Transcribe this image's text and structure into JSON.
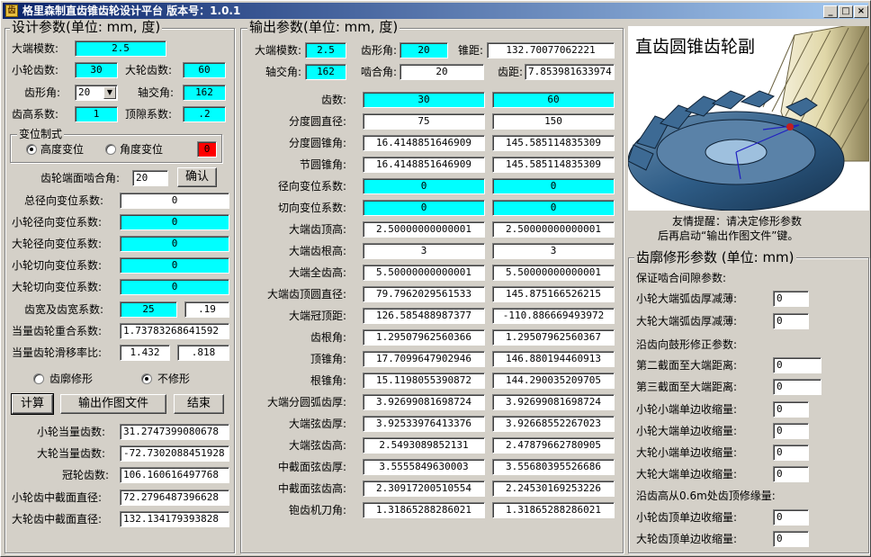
{
  "window": {
    "title": "格里森制直齿锥齿轮设计平台   版本号：1.0.1",
    "icon": "app-icon"
  },
  "design": {
    "title": "设计参数(单位: mm, 度)",
    "module_label": "大端模数:",
    "module": "2.5",
    "z1_label": "小轮齿数:",
    "z1": "30",
    "z2_label": "大轮齿数:",
    "z2": "60",
    "alpha_label": "齿形角:",
    "alpha": "20",
    "sigma_label": "轴交角:",
    "sigma": "162",
    "ha_label": "齿高系数:",
    "ha": "1",
    "c_label": "顶隙系数:",
    "c": ".2",
    "shift": {
      "title": "变位制式",
      "opt1": "高度变位",
      "opt2": "角度变位",
      "value": "0"
    },
    "pressure_label": "齿轮端面啮合角:",
    "pressure": "20",
    "confirm": "确认",
    "total_x_label": "总径向变位系数:",
    "total_x": "0",
    "x1_label": "小轮径向变位系数:",
    "x1": "0",
    "x2_label": "大轮径向变位系数:",
    "x2": "0",
    "xt1_label": "小轮切向变位系数:",
    "xt1": "0",
    "xt2_label": "大轮切向变位系数:",
    "xt2": "0",
    "width_label": "齿宽及齿宽系数:",
    "width": "25",
    "width_coef": ".19",
    "overlap_label": "当量齿轮重合系数:",
    "overlap": "1.73783268641592",
    "slide_label": "当量齿轮滑移率比:",
    "slide1": "1.432",
    "slide2": ".818",
    "mod_opt1": "齿廓修形",
    "mod_opt2": "不修形",
    "btn_calc": "计算",
    "btn_export": "输出作图文件",
    "btn_end": "结束",
    "zv1_label": "小轮当量齿数:",
    "zv1": "31.2747399080678",
    "zv2_label": "大轮当量齿数:",
    "zv2": "-72.7302088451928",
    "zc_label": "冠轮齿数:",
    "zc": "106.160616497768",
    "dm1_label": "小轮齿中截面直径:",
    "dm1": "72.2796487396628",
    "dm2_label": "大轮齿中截面直径:",
    "dm2": "132.134179393828"
  },
  "output": {
    "title": "输出参数(单位: mm, 度)",
    "head": {
      "module_label": "大端模数:",
      "module": "2.5",
      "alpha_label": "齿形角:",
      "alpha": "20",
      "cone_label": "锥距:",
      "cone": "132.70077062221",
      "sigma_label": "轴交角:",
      "sigma": "162",
      "mesh_label": "啮合角:",
      "mesh": "20",
      "pitch_label": "齿距:",
      "pitch": "7.853981633974"
    },
    "rows": [
      {
        "label": "齿数:",
        "v1": "30",
        "v2": "60",
        "cyan": true
      },
      {
        "label": "分度圆直径:",
        "v1": "75",
        "v2": "150",
        "cyan": false
      },
      {
        "label": "分度圆锥角:",
        "v1": "16.4148851646909",
        "v2": "145.585114835309",
        "cyan": false
      },
      {
        "label": "节圆锥角:",
        "v1": "16.4148851646909",
        "v2": "145.585114835309",
        "cyan": false
      },
      {
        "label": "径向变位系数:",
        "v1": "0",
        "v2": "0",
        "cyan": true
      },
      {
        "label": "切向变位系数:",
        "v1": "0",
        "v2": "0",
        "cyan": true
      },
      {
        "label": "大端齿顶高:",
        "v1": "2.50000000000001",
        "v2": "2.50000000000001",
        "cyan": false
      },
      {
        "label": "大端齿根高:",
        "v1": "3",
        "v2": "3",
        "cyan": false
      },
      {
        "label": "大端全齿高:",
        "v1": "5.50000000000001",
        "v2": "5.50000000000001",
        "cyan": false
      },
      {
        "label": "大端齿顶圆直径:",
        "v1": "79.7962029561533",
        "v2": "145.875166526215",
        "cyan": false
      },
      {
        "label": "大端冠顶距:",
        "v1": "126.585488987377",
        "v2": "-110.886669493972",
        "cyan": false
      },
      {
        "label": "齿根角:",
        "v1": "1.29507962560366",
        "v2": "1.29507962560367",
        "cyan": false
      },
      {
        "label": "顶锥角:",
        "v1": "17.7099647902946",
        "v2": "146.880194460913",
        "cyan": false
      },
      {
        "label": "根锥角:",
        "v1": "15.1198055390872",
        "v2": "144.290035209705",
        "cyan": false
      },
      {
        "label": "大端分圆弧齿厚:",
        "v1": "3.92699081698724",
        "v2": "3.92699081698724",
        "cyan": false
      },
      {
        "label": "大端弦齿厚:",
        "v1": "3.92533976413376",
        "v2": "3.92668552267023",
        "cyan": false
      },
      {
        "label": "大端弦齿高:",
        "v1": "2.5493089852131",
        "v2": "2.47879662780905",
        "cyan": false
      },
      {
        "label": "中截面弦齿厚:",
        "v1": "3.5555849630003",
        "v2": "3.55680395526686",
        "cyan": false
      },
      {
        "label": "中截面弦齿高:",
        "v1": "2.30917200510554",
        "v2": "2.24530169253226",
        "cyan": false
      },
      {
        "label": "铇齿机刀角:",
        "v1": "1.31865288286021",
        "v2": "1.31865288286021",
        "cyan": false
      }
    ]
  },
  "preview": {
    "title": "直齿圆锥齿轮副",
    "image": "bevel-gear-pair-render"
  },
  "tip": {
    "line1": "友情提醒：请决定修形参数",
    "line2": "后再启动“输出作图文件”键。"
  },
  "profile": {
    "title": "齿廓修形参数 (单位: mm)",
    "sec1": "保证啮合间隙参数:",
    "sec2": "沿齿向鼓形修正参数:",
    "sec3": "沿齿高从0.6m处齿顶修缘量:",
    "items": [
      {
        "label": "小轮大端弧齿厚减薄:",
        "value": "0"
      },
      {
        "label": "大轮大端弧齿厚减薄:",
        "value": "0"
      },
      {
        "label": "第二截面至大端距离:",
        "value": "0"
      },
      {
        "label": "第三截面至大端距离:",
        "value": "0"
      },
      {
        "label": "小轮小端单边收缩量:",
        "value": "0"
      },
      {
        "label": "小轮大端单边收缩量:",
        "value": "0"
      },
      {
        "label": "大轮小端单边收缩量:",
        "value": "0"
      },
      {
        "label": "大轮大端单边收缩量:",
        "value": "0"
      },
      {
        "label": "小轮齿顶单边收缩量:",
        "value": "0"
      },
      {
        "label": "大轮齿顶单边收缩量:",
        "value": "0"
      }
    ]
  },
  "colors": {
    "highlight": "#00ffff",
    "alert": "#ff0000",
    "titlebar": "#0a246a"
  }
}
